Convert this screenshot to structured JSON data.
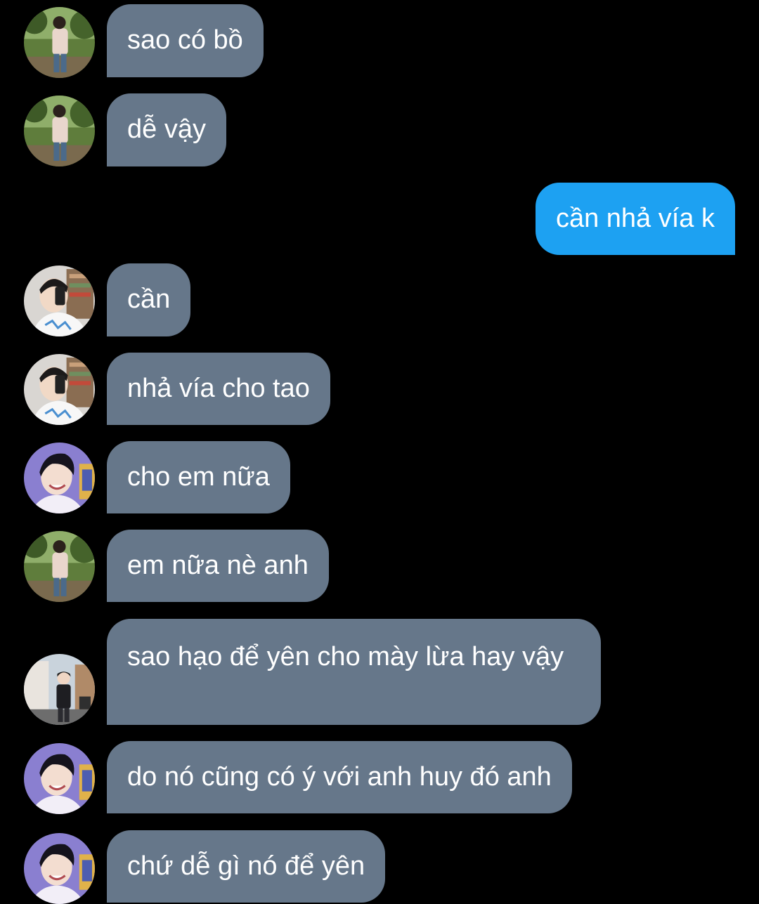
{
  "thread": {
    "messages": [
      {
        "text": "sao có bồ",
        "sender": "other",
        "avatar": "user-park-avatar"
      },
      {
        "text": "dễ vậy",
        "sender": "other",
        "avatar": "user-park-avatar"
      },
      {
        "text": "cần nhả vía k",
        "sender": "me"
      },
      {
        "text": "cần",
        "sender": "other",
        "avatar": "user-mirror-avatar"
      },
      {
        "text": "nhả vía cho tao",
        "sender": "other",
        "avatar": "user-mirror-avatar"
      },
      {
        "text": "cho em nữa",
        "sender": "other",
        "avatar": "user-smile-avatar"
      },
      {
        "text": "em nữa nè anh",
        "sender": "other",
        "avatar": "user-park-avatar"
      },
      {
        "text": "sao hạo để yên cho mày lừa hay vậy",
        "sender": "other",
        "avatar": "user-street-avatar"
      },
      {
        "text": "do nó cũng có ý với anh huy đó anh",
        "sender": "other",
        "avatar": "user-smile-avatar"
      },
      {
        "text": "chứ dễ gì nó để yên",
        "sender": "other",
        "avatar": "user-smile-avatar"
      }
    ]
  },
  "colors": {
    "background": "#000000",
    "incoming_bubble": "#66778a",
    "outgoing_bubble": "#1da1f2",
    "text": "#ffffff"
  }
}
